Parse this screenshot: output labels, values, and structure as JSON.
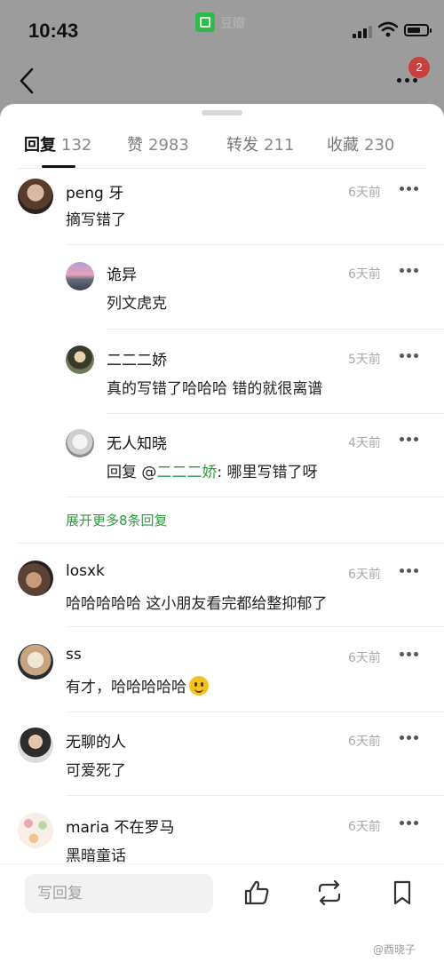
{
  "status_bar": {
    "time": "10:43",
    "app_label": "豆瓣"
  },
  "header": {
    "notification_count": "2"
  },
  "tabs": [
    {
      "label": "回复",
      "count": "132",
      "active": true
    },
    {
      "label": "赞",
      "count": "2983",
      "active": false
    },
    {
      "label": "转发",
      "count": "211",
      "active": false
    },
    {
      "label": "收藏",
      "count": "230",
      "active": false
    }
  ],
  "comments": [
    {
      "name": "peng 牙",
      "time": "6天前",
      "text": "摘写错了"
    },
    {
      "name": "诡异",
      "time": "6天前",
      "text": "列文虎克"
    },
    {
      "name": "二二二娇",
      "time": "5天前",
      "text": "真的写错了哈哈哈  错的就很离谱"
    },
    {
      "name": "无人知晓",
      "time": "4天前",
      "text_prefix": "回复 @",
      "mention": "二二二娇",
      "text_suffix": ": 哪里写错了呀"
    },
    {
      "name": "losxk",
      "time": "6天前",
      "text": "哈哈哈哈哈 这小朋友看完都给整抑郁了"
    },
    {
      "name": "ss",
      "time": "6天前",
      "text": "有才，哈哈哈哈哈"
    },
    {
      "name": "无聊的人",
      "time": "6天前",
      "text": "可爱死了"
    },
    {
      "name": "maria 不在罗马",
      "time": "6天前",
      "text": "黑暗童话"
    }
  ],
  "expand_replies": "展开更多8条回复",
  "bottom_bar": {
    "reply_placeholder": "写回复"
  },
  "watermark": "@酉晓子",
  "icons": [
    "back-icon",
    "more-icon",
    "like-icon",
    "repost-icon",
    "bookmark-icon",
    "smile-emoji-icon"
  ]
}
